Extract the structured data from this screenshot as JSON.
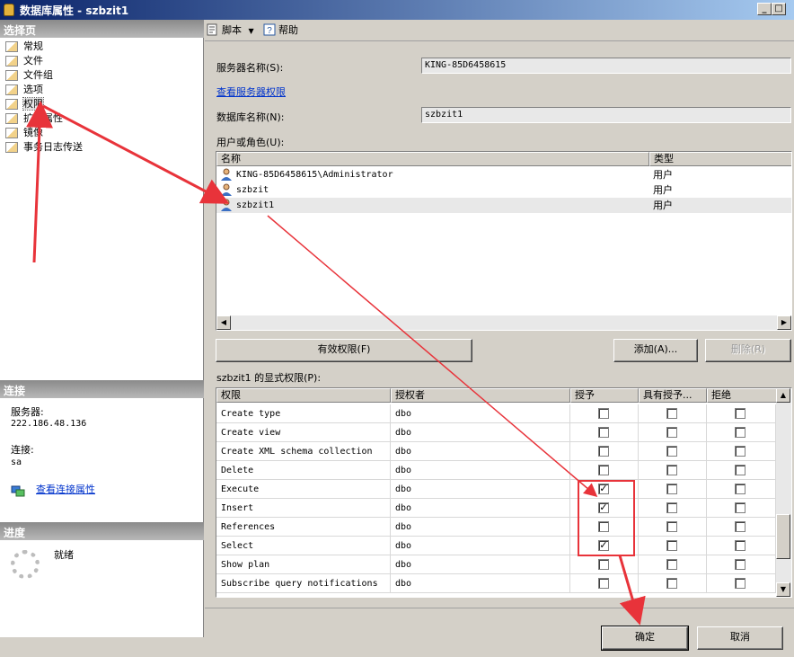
{
  "window": {
    "title": "数据库属性 - szbzit1",
    "controls": [
      "_",
      "□",
      "×"
    ]
  },
  "left": {
    "select_page_header": "选择页",
    "pages": [
      {
        "label": "常规",
        "icon": "page-icon"
      },
      {
        "label": "文件",
        "icon": "page-icon"
      },
      {
        "label": "文件组",
        "icon": "page-icon"
      },
      {
        "label": "选项",
        "icon": "page-icon"
      },
      {
        "label": "权限",
        "icon": "page-icon",
        "selected": true
      },
      {
        "label": "扩展属性",
        "icon": "page-icon"
      },
      {
        "label": "镜像",
        "icon": "page-icon"
      },
      {
        "label": "事务日志传送",
        "icon": "page-icon"
      }
    ],
    "connection_header": "连接",
    "server_label": "服务器:",
    "server_value": "222.186.48.136",
    "conn_label": "连接:",
    "conn_value": "sa",
    "view_conn_props": "查看连接属性",
    "progress_header": "进度",
    "progress_status": "就绪"
  },
  "toolbar": {
    "script_label": "脚本",
    "help_label": "帮助"
  },
  "form": {
    "server_name_label": "服务器名称(S):",
    "server_name_value": "KING-85D6458615",
    "view_server_perms": "查看服务器权限",
    "db_name_label": "数据库名称(N):",
    "db_name_value": "szbzit1",
    "users_label": "用户或角色(U):",
    "users_columns": [
      "名称",
      "类型"
    ],
    "users": [
      {
        "name": "KING-85D6458615\\Administrator",
        "type": "用户"
      },
      {
        "name": "szbzit",
        "type": "用户"
      },
      {
        "name": "szbzit1",
        "type": "用户",
        "selected": true
      }
    ],
    "effective_perms_btn": "有效权限(F)",
    "add_btn": "添加(A)...",
    "remove_btn": "删除(R)",
    "explicit_perms_label": "szbzit1 的显式权限(P):",
    "perm_columns": [
      "权限",
      "授权者",
      "授予",
      "具有授予...",
      "拒绝"
    ],
    "permissions": [
      {
        "perm": "Create type",
        "grantor": "dbo",
        "grant": false,
        "with_grant": false,
        "deny": false
      },
      {
        "perm": "Create view",
        "grantor": "dbo",
        "grant": false,
        "with_grant": false,
        "deny": false
      },
      {
        "perm": "Create XML schema collection",
        "grantor": "dbo",
        "grant": false,
        "with_grant": false,
        "deny": false
      },
      {
        "perm": "Delete",
        "grantor": "dbo",
        "grant": false,
        "with_grant": false,
        "deny": false
      },
      {
        "perm": "Execute",
        "grantor": "dbo",
        "grant": true,
        "with_grant": false,
        "deny": false
      },
      {
        "perm": "Insert",
        "grantor": "dbo",
        "grant": true,
        "with_grant": false,
        "deny": false
      },
      {
        "perm": "References",
        "grantor": "dbo",
        "grant": false,
        "with_grant": false,
        "deny": false
      },
      {
        "perm": "Select",
        "grantor": "dbo",
        "grant": true,
        "with_grant": false,
        "deny": false
      },
      {
        "perm": "Show plan",
        "grantor": "dbo",
        "grant": false,
        "with_grant": false,
        "deny": false
      },
      {
        "perm": "Subscribe query notifications",
        "grantor": "dbo",
        "grant": false,
        "with_grant": false,
        "deny": false
      }
    ]
  },
  "footer": {
    "ok_btn": "确定",
    "cancel_btn": "取消"
  },
  "colors": {
    "annotation": "#e8333a",
    "link": "#0033cc",
    "title_start": "#0a246a",
    "title_end": "#a6caf0"
  }
}
